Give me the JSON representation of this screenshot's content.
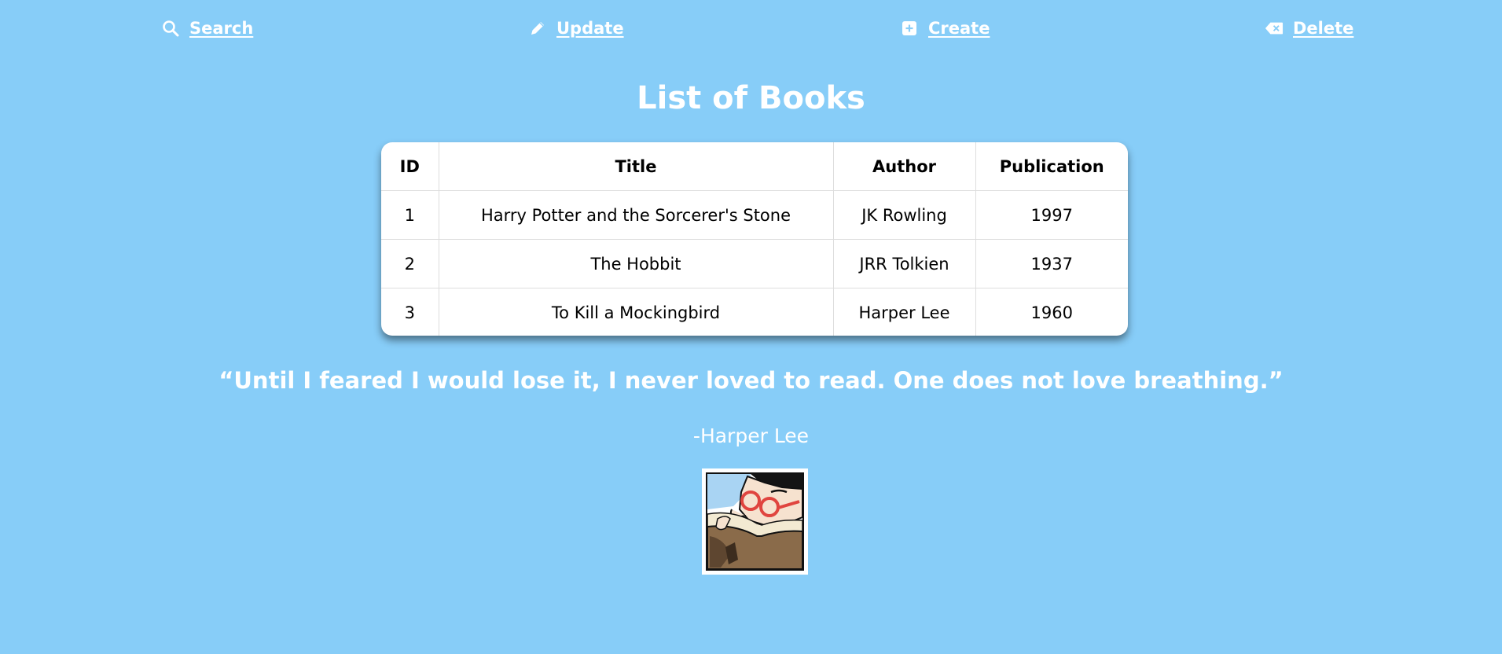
{
  "nav": {
    "search": {
      "label": "Search",
      "icon": "search-icon"
    },
    "update": {
      "label": "Update",
      "icon": "pencil-icon"
    },
    "create": {
      "label": "Create",
      "icon": "plus-square-icon"
    },
    "delete": {
      "label": "Delete",
      "icon": "backspace-icon"
    }
  },
  "page": {
    "title": "List of Books"
  },
  "table": {
    "headers": [
      "ID",
      "Title",
      "Author",
      "Publication"
    ],
    "rows": [
      {
        "id": "1",
        "title": "Harry Potter and the Sorcerer's Stone",
        "author": "JK Rowling",
        "publication": "1997"
      },
      {
        "id": "2",
        "title": "The Hobbit",
        "author": "JRR Tolkien",
        "publication": "1937"
      },
      {
        "id": "3",
        "title": "To Kill a Mockingbird",
        "author": "Harper Lee",
        "publication": "1960"
      }
    ]
  },
  "quote": {
    "text": "“Until I feared I would lose it, I never loved to read. One does not love breathing.”",
    "author": "-Harper Lee"
  },
  "illustration": {
    "icon": "reading-person-illustration"
  },
  "colors": {
    "background": "#87cdf8",
    "text": "#ffffff",
    "table_bg": "#ffffff"
  }
}
